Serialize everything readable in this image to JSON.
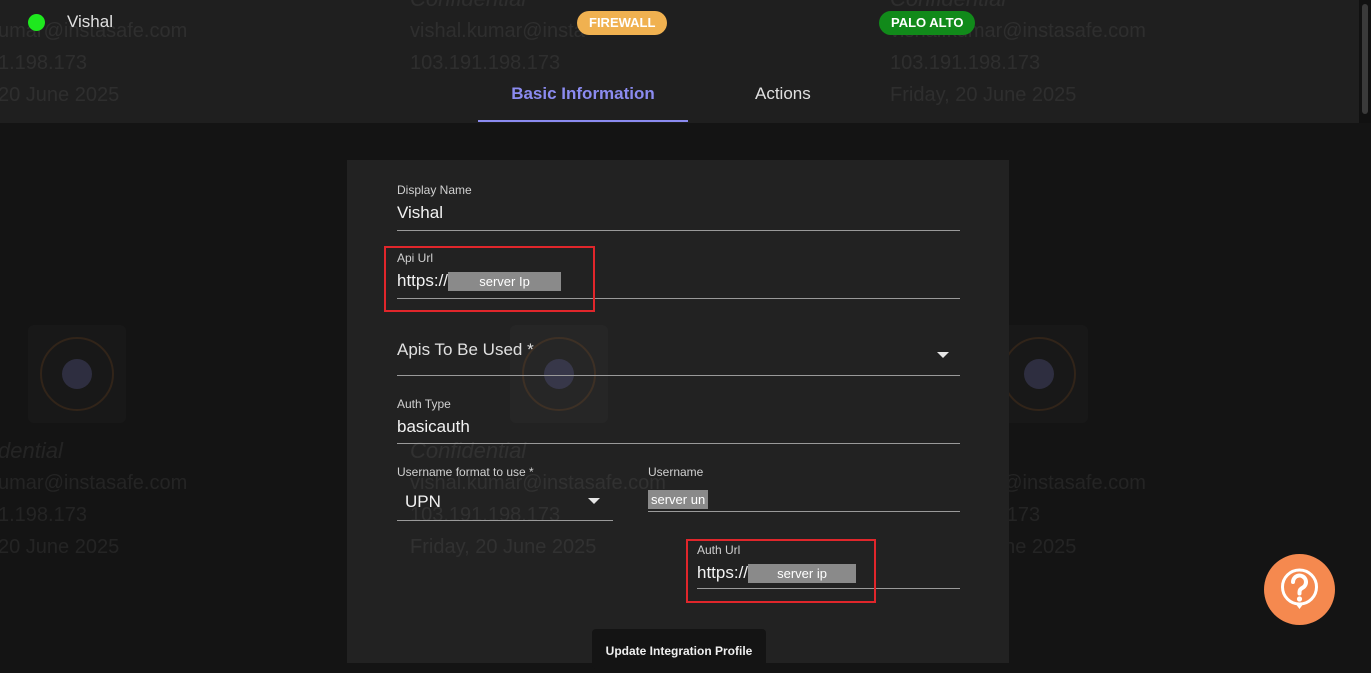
{
  "device": {
    "name": "Vishal",
    "status_color": "#1ee81e"
  },
  "badges": {
    "type": "FIREWALL",
    "vendor": "PALO ALTO"
  },
  "tabs": {
    "basic": "Basic Information",
    "actions": "Actions"
  },
  "watermark": {
    "confidential": "Confidential",
    "email": "vishal.kumar@instasafe.com",
    "ip": "103.191.198.173",
    "date": "Friday, 20 June 2025",
    "email_cut": "umar@instasafe.com",
    "ip_cut": "1.198.173",
    "date_cut": "20 June 2025",
    "conf_cut": "dential",
    "email_mid": "vishal.kumar@insta"
  },
  "form": {
    "display_name": {
      "label": "Display Name",
      "value": "Vishal"
    },
    "api_url": {
      "label": "Api Url",
      "prefix": "https://",
      "mask": "server Ip"
    },
    "apis_to_be_used": {
      "label": "Apis To Be Used *"
    },
    "auth_type": {
      "label": "Auth Type",
      "value": "basicauth"
    },
    "username_format": {
      "label": "Username format to use *",
      "value": "UPN"
    },
    "username": {
      "label": "Username",
      "mask": "server un"
    },
    "auth_url": {
      "label": "Auth Url",
      "prefix": "https://",
      "mask": "server ip"
    },
    "submit": "Update Integration Profile"
  },
  "colors": {
    "accent": "#8b8bf0",
    "highlight_box": "#e0262b",
    "help": "#f5894f",
    "firewall_badge": "#f0b150",
    "vendor_badge": "#118a1a"
  }
}
